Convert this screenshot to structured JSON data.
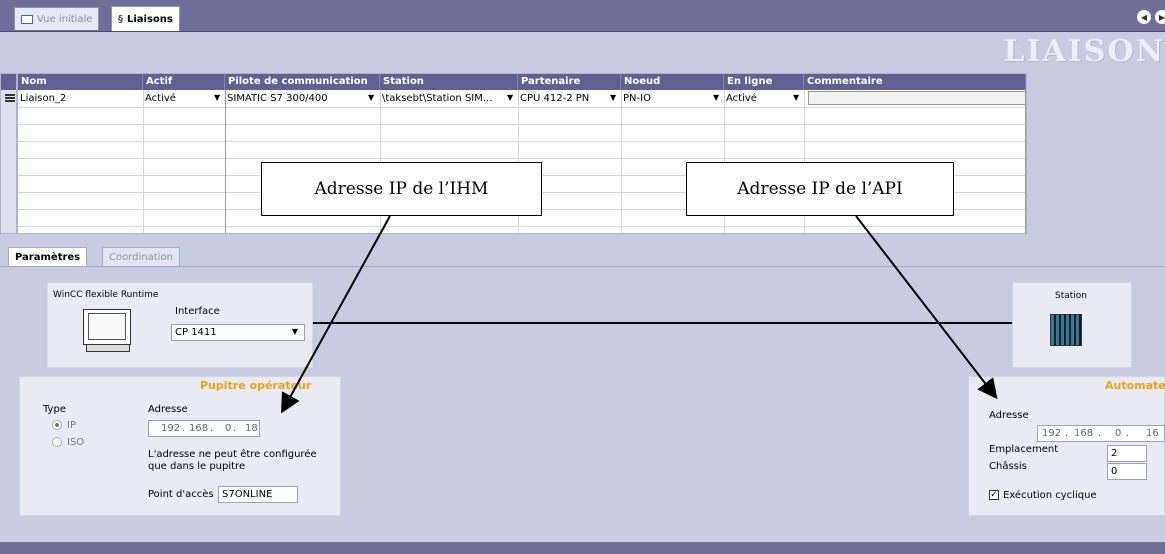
{
  "tabs": {
    "initial": "Vue initiale",
    "connections": "Liaisons"
  },
  "header": {
    "title": "LIAISON"
  },
  "grid": {
    "columns": [
      "Nom",
      "Actif",
      "Pilote de communication",
      "Station",
      "Partenaire",
      "Noeud",
      "En ligne",
      "Commentaire"
    ],
    "row": {
      "nom": "Liaison_2",
      "actif": "Activé",
      "pilote": "SIMATIC S7 300/400",
      "station": "\\taksebt\\Station SIM...",
      "partenaire": "CPU 412-2 PN",
      "noeud": "PN-IO",
      "en_ligne": "Activé",
      "commentaire": ""
    }
  },
  "callouts": {
    "ihm": "Adresse IP de l’IHM",
    "api": "Adresse IP de l’API"
  },
  "lower_tabs": {
    "params": "Paramètres",
    "coordination": "Coordination"
  },
  "hmi": {
    "runtime": "WinCC flexible Runtime",
    "interface_label": "Interface",
    "interface_value": "CP 1411",
    "station_label": "Station"
  },
  "operator_panel": {
    "title": "Pupitre opérateur",
    "type_label": "Type",
    "type_ip": "IP",
    "type_iso": "ISO",
    "address_label": "Adresse",
    "ip": [
      "192",
      "168",
      "0",
      "18"
    ],
    "note": "L'adresse ne peut être configurée que dans le pupitre",
    "access_label": "Point d'accès",
    "access_value": "S7ONLINE"
  },
  "automate": {
    "title": "Automate",
    "address_label": "Adresse",
    "ip": [
      "192",
      "168",
      "0",
      "16"
    ],
    "slot_label": "Emplacement",
    "slot_value": "2",
    "rack_label": "Châssis",
    "rack_value": "0",
    "cyclic_label": "Exécution cyclique"
  },
  "colors": {
    "header_bar": "#6d6f99",
    "column_header": "#5f6190",
    "accent_title": "#e8a21c",
    "background": "#c9cbe0"
  }
}
